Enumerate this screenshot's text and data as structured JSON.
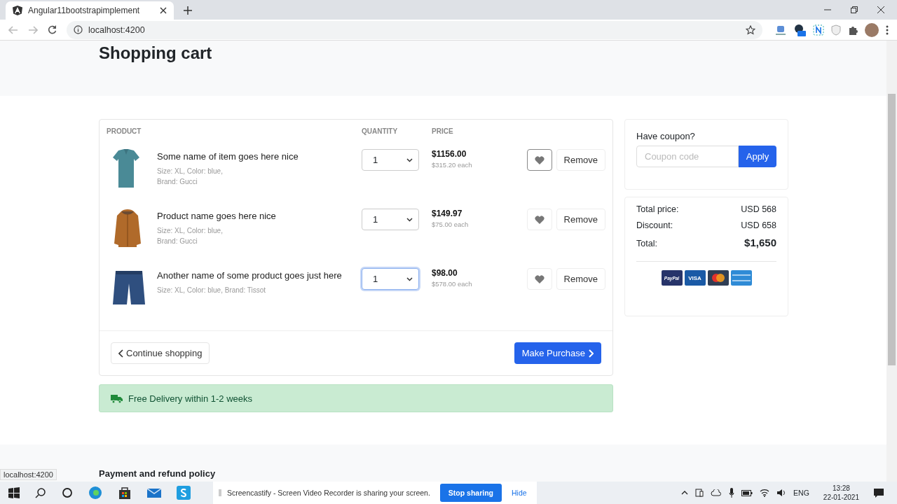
{
  "browser": {
    "tab_title": "Angular11bootstrapimplement",
    "address": "localhost:4200",
    "status_url": "localhost:4200"
  },
  "page": {
    "title": "Shopping cart",
    "table": {
      "columns": [
        "PRODUCT",
        "QUANTITY",
        "PRICE"
      ],
      "rows": [
        {
          "name": "Some name of item goes here nice",
          "details": "Size: XL, Color: blue,\nBrand: Gucci",
          "kind": "shirt",
          "quantity": "1",
          "quantity_focused": false,
          "total": "$1156.00",
          "each": "$315.20 each",
          "heart_hovered": true,
          "remove": "Remove"
        },
        {
          "name": "Product name goes here nice",
          "details": "Size: XL, Color: blue,\nBrand: Gucci",
          "kind": "jacket",
          "quantity": "1",
          "quantity_focused": false,
          "total": "$149.97",
          "each": "$75.00 each",
          "heart_hovered": false,
          "remove": "Remove"
        },
        {
          "name": "Another name of some product goes just here",
          "details": "Size: XL, Color: blue, Brand: Tissot",
          "kind": "shorts",
          "quantity": "1",
          "quantity_focused": true,
          "total": "$98.00",
          "each": "$578.00 each",
          "heart_hovered": false,
          "remove": "Remove"
        }
      ]
    },
    "continue_button": "Continue shopping",
    "purchase_button": "Make Purchase",
    "delivery_notice": "Free Delivery within 1-2 weeks",
    "coupon": {
      "label": "Have coupon?",
      "placeholder": "Coupon code",
      "button": "Apply"
    },
    "summary": [
      {
        "label": "Total price:",
        "value": "USD 568",
        "emphasis": false
      },
      {
        "label": "Discount:",
        "value": "USD 658",
        "emphasis": false
      },
      {
        "label": "Total:",
        "value": "$1,650",
        "emphasis": true
      }
    ],
    "payment_cards": [
      {
        "kind": "paypal",
        "label": "PayPal"
      },
      {
        "kind": "visa",
        "label": "VISA"
      },
      {
        "kind": "mastercard"
      },
      {
        "kind": "amex"
      }
    ],
    "policy_heading": "Payment and refund policy"
  },
  "taskbar": {
    "share_notice": "Screencastify - Screen Video Recorder is sharing your screen.",
    "stop_button": "Stop sharing",
    "hide_button": "Hide",
    "language": "ENG",
    "time": "13:28",
    "date": "22-01-2021"
  }
}
